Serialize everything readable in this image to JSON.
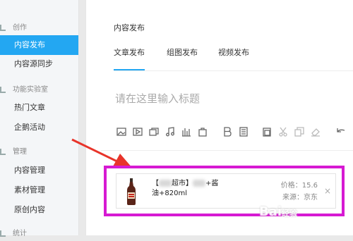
{
  "sidebar": {
    "sections": [
      {
        "label": "创作"
      },
      {
        "label": "功能实验室"
      },
      {
        "label": "管理"
      },
      {
        "label": "统计"
      }
    ],
    "items": [
      {
        "label": "内容发布"
      },
      {
        "label": "内容源同步"
      },
      {
        "label": "热门文章"
      },
      {
        "label": "企鹅活动"
      },
      {
        "label": "内容管理"
      },
      {
        "label": "素材管理"
      },
      {
        "label": "原创内容"
      }
    ],
    "active_color": "#23a7f2"
  },
  "main": {
    "page_title": "内容发布",
    "tabs": [
      {
        "label": "文章发布"
      },
      {
        "label": "组图发布"
      },
      {
        "label": "视频发布"
      }
    ],
    "title_placeholder": "请在这里输入标题",
    "toolbar_icons": [
      "image-icon",
      "video-icon",
      "gallery-icon",
      "music-icon",
      "chart-icon",
      "shopping-bag-icon",
      "bold-icon",
      "quote-icon",
      "paste-icon",
      "cut-icon",
      "copy-icon",
      "eraser-icon",
      "undo-icon"
    ]
  },
  "product": {
    "name_prefix": "【",
    "name_mid": "超市】",
    "name_suffix": "+酱",
    "name_line2": "油+820ml",
    "price": "价格：15.6",
    "source": "来源：京东",
    "close": "×"
  },
  "annotation": {
    "highlight_color": "#d61ad2",
    "arrow_color": "#e8342a"
  },
  "watermark": {
    "text": "Bai",
    "small": "经验"
  }
}
